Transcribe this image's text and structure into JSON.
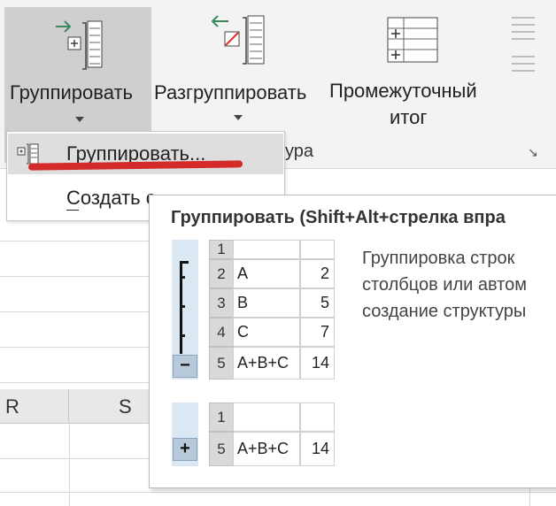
{
  "ribbon": {
    "group_label": "Группировать",
    "ungroup_label": "Разгруппировать",
    "subtotal_label_line1": "Промежуточный",
    "subtotal_label_line2": "итог",
    "partial_group_text": "ура",
    "launcher_glyph": "↘"
  },
  "menu": {
    "items": [
      {
        "label": "Группировать..."
      },
      {
        "label": "Создать с",
        "underlined_char": "С"
      }
    ]
  },
  "sheet": {
    "columns": [
      "R",
      "S"
    ]
  },
  "tooltip": {
    "title": "Группировать (Shift+Alt+стрелка впра",
    "description": [
      "Группировка строк",
      "столбцов или автом",
      "создание структуры"
    ],
    "example_expanded": {
      "rows": [
        {
          "num": "1",
          "text": "",
          "value": ""
        },
        {
          "num": "2",
          "text": "A",
          "value": "2"
        },
        {
          "num": "3",
          "text": "B",
          "value": "5"
        },
        {
          "num": "4",
          "text": "C",
          "value": "7"
        },
        {
          "num": "5",
          "text": "A+B+C",
          "value": "14"
        }
      ],
      "button": "−"
    },
    "example_collapsed": {
      "rows": [
        {
          "num": "1",
          "text": "",
          "value": ""
        },
        {
          "num": "5",
          "text": "A+B+C",
          "value": "14"
        }
      ],
      "button": "+"
    }
  },
  "colors": {
    "highlight_red": "#d42a2a",
    "outline_blue": "#dbe7f3",
    "ribbon_bg": "#f3f3f3"
  }
}
